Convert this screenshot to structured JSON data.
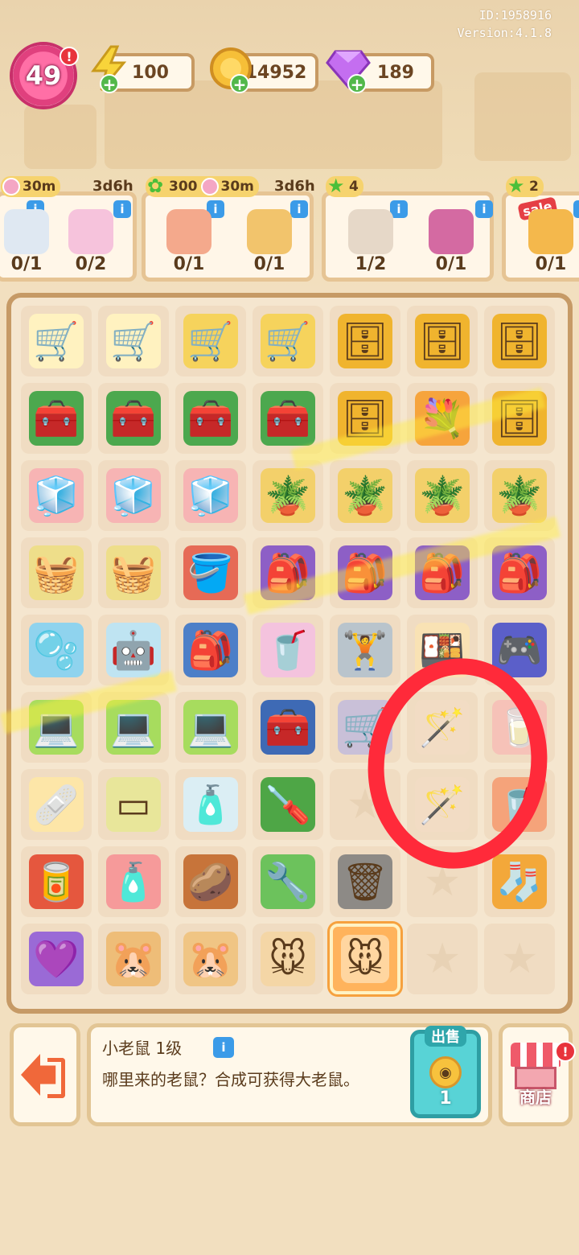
{
  "meta": {
    "player_id": "ID:1958916",
    "version": "Version:4.1.8"
  },
  "player": {
    "level": "49"
  },
  "resources": {
    "energy": "100",
    "coins": "14952",
    "gems": "189"
  },
  "orders": [
    {
      "tags": [
        "30m",
        "3d6h"
      ],
      "items": [
        {
          "name": "bathtub",
          "count": "0/1"
        },
        {
          "name": "flowers",
          "count": "0/2"
        }
      ]
    },
    {
      "tags": [
        "300",
        "30m",
        "3d6h"
      ],
      "items": [
        {
          "name": "bouquet",
          "count": "0/1"
        },
        {
          "name": "lion-card",
          "count": "0/1"
        }
      ]
    },
    {
      "tags": [
        "4"
      ],
      "items": [
        {
          "name": "shovel",
          "count": "1/2"
        },
        {
          "name": "pallet",
          "count": "0/1"
        }
      ]
    },
    {
      "tags": [
        "2"
      ],
      "sale": "sale",
      "items": [
        {
          "name": "cup",
          "count": "0/1"
        }
      ]
    }
  ],
  "board_rows": [
    [
      "duck-cart",
      "duck-cart",
      "yellow-cart",
      "yellow-cart",
      "cabinet",
      "cabinet",
      "cabinet"
    ],
    [
      "green-box",
      "green-box",
      "green-box",
      "green-box",
      "cabinet",
      "flower-basket",
      "cabinet"
    ],
    [
      "pink-fridge",
      "pink-fridge",
      "pink-fridge",
      "plant-pot",
      "plant-pot",
      "plant-pot",
      "plant-pot"
    ],
    [
      "basket",
      "basket",
      "bucket",
      "robot-bag",
      "robot-bag",
      "robot-bag",
      "robot-bag"
    ],
    [
      "washer",
      "robot-vacuum",
      "backpack",
      "shaker",
      "grip",
      "dish",
      "console"
    ],
    [
      "laptop",
      "laptop",
      "laptop",
      "toolbox",
      "cart",
      "magic-wand",
      "milk"
    ],
    [
      "first-aid",
      "tray",
      "bottle",
      "screwdriver",
      "empty",
      "magic-wand",
      "cup"
    ],
    [
      "soda-can",
      "lotion",
      "potato",
      "pipe",
      "trash-bag",
      "empty",
      "sock"
    ],
    [
      "lavender",
      "hamsters",
      "hamster",
      "mouse",
      "mouse-selected",
      "empty",
      "empty"
    ]
  ],
  "selected_item": {
    "title": "小老鼠 1级",
    "description": "哪里来的老鼠？合成可获得大老鼠。"
  },
  "sell": {
    "label": "出售",
    "value": "1"
  },
  "shop": {
    "label": "商店"
  }
}
